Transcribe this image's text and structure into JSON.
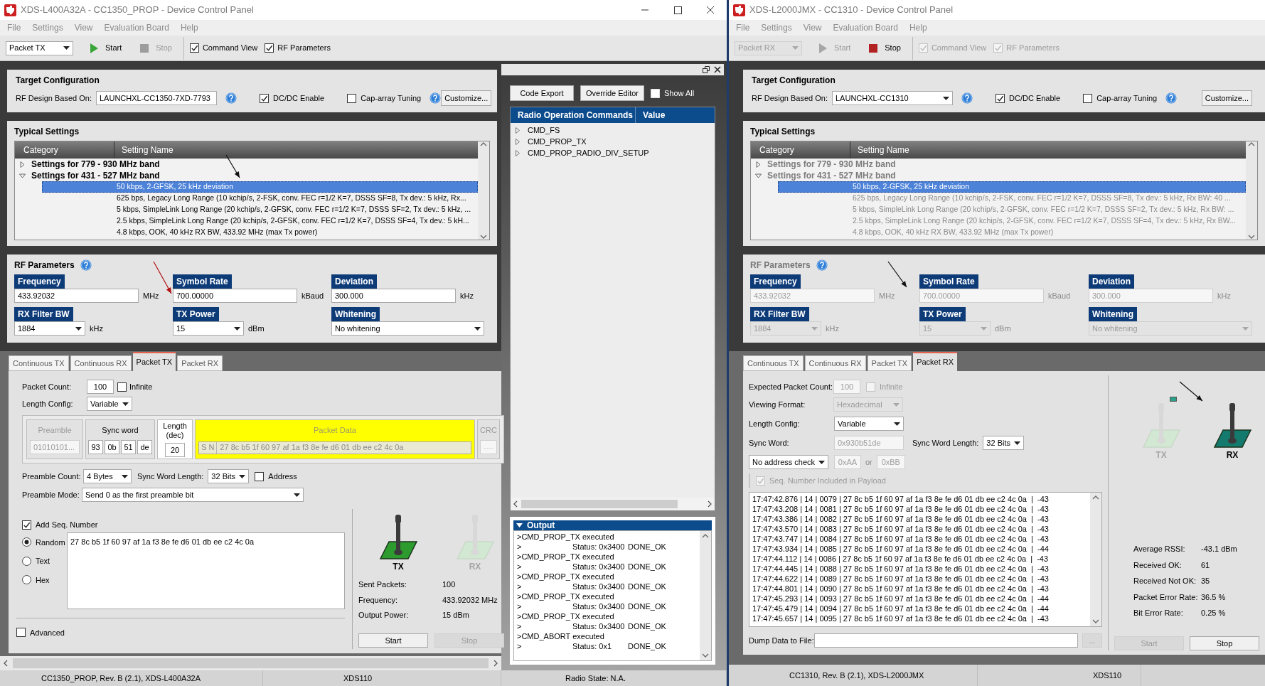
{
  "windows": [
    {
      "title": "XDS-L400A32A - CC1350_PROP - Device Control Panel",
      "window_controls": true,
      "menu": [
        "File",
        "Settings",
        "View",
        "Evaluation Board",
        "Help"
      ],
      "toolbar": {
        "mode": {
          "value": "Packet TX",
          "disabled": false
        },
        "start": {
          "label": "Start",
          "disabled": false
        },
        "stop": {
          "label": "Stop",
          "disabled": true
        },
        "toggles": [
          {
            "label": "Command View",
            "checked": true,
            "disabled": false
          },
          {
            "label": "RF Parameters",
            "checked": true,
            "disabled": false
          }
        ]
      },
      "target_configuration": {
        "title": "Target Configuration",
        "rf_design": {
          "label": "RF Design Based On:",
          "value": "LAUNCHXL-CC1350-7XD-7793"
        },
        "options": [
          {
            "label": "DC/DC Enable",
            "checked": true
          },
          {
            "label": "Cap-array Tuning",
            "checked": false
          }
        ],
        "customize": "Customize..."
      },
      "typical_settings": {
        "title": "Typical Settings",
        "disabled": false,
        "columns": [
          "Category",
          "Setting Name"
        ],
        "groups": [
          {
            "label": "Settings for 779 - 930 MHz band",
            "expanded": false
          },
          {
            "label": "Settings for 431 - 527 MHz band",
            "expanded": true,
            "children": [
              {
                "label": "50 kbps, 2-GFSK, 25 kHz deviation",
                "selected": true
              },
              {
                "label": "625 bps, Legacy Long Range (10 kchip/s, 2-FSK, conv. FEC r=1/2 K=7, DSSS SF=8, Tx dev.: 5 kHz, Rx...",
                "selected": false
              },
              {
                "label": "5 kbps, SimpleLink Long Range (20 kchip/s, 2-GFSK, conv. FEC r=1/2 K=7, DSSS SF=2, Tx dev.: 5 kHz, ...",
                "selected": false
              },
              {
                "label": "2.5 kbps, SimpleLink Long Range (20 kchip/s, 2-GFSK, conv. FEC r=1/2 K=7, DSSS SF=4, Tx dev.: 5 kH...",
                "selected": false
              },
              {
                "label": "4.8 kbps, OOK, 40 kHz RX BW, 433.92 MHz (max Tx power)",
                "selected": false
              }
            ]
          }
        ]
      },
      "rf_parameters": {
        "title": "RF Parameters",
        "disabled": false,
        "fields": [
          {
            "kind": "input",
            "label": "Frequency",
            "value": "433.92032",
            "unit": "MHz"
          },
          {
            "kind": "input",
            "label": "Symbol Rate",
            "value": "700.00000",
            "unit": "kBaud"
          },
          {
            "kind": "input",
            "label": "Deviation",
            "value": "300.000",
            "unit": "kHz"
          },
          {
            "kind": "select",
            "label": "RX Filter BW",
            "value": "1884",
            "unit": "kHz"
          },
          {
            "kind": "select",
            "label": "TX Power",
            "value": "15",
            "unit": "dBm"
          },
          {
            "kind": "select",
            "label": "Whitening",
            "value": "No whitening"
          }
        ]
      },
      "tabs": [
        {
          "label": "Continuous TX",
          "selected": false
        },
        {
          "label": "Continuous RX",
          "selected": false
        },
        {
          "label": "Packet TX",
          "selected": true
        },
        {
          "label": "Packet RX",
          "selected": false
        }
      ],
      "panel": {
        "kind": "packet_tx",
        "packet_count": {
          "label": "Packet Count:",
          "value": "100"
        },
        "infinite": {
          "label": "Infinite",
          "checked": false
        },
        "length_config": {
          "label": "Length Config:",
          "value": "Variable"
        },
        "structure": {
          "preamble": {
            "label": "Preamble",
            "value": "01010101...",
            "disabled": true
          },
          "sync_word": {
            "label": "Sync word",
            "bytes": [
              "93",
              "0b",
              "51",
              "de"
            ]
          },
          "length": {
            "label": "Length (dec)",
            "value": "20"
          },
          "packet_data": {
            "label": "Packet Data",
            "prefix": "S N",
            "value": "27 8c b5 1f 60 97 af 1a f3 8e fe d6 01 db ee c2 4c 0a"
          },
          "crc": {
            "label": "CRC",
            "value": "......",
            "disabled": true
          }
        },
        "preamble_count": {
          "label": "Preamble Count:",
          "value": "4 Bytes"
        },
        "sync_word_length": {
          "label": "Sync Word Length:",
          "value": "32 Bits"
        },
        "address": {
          "label": "Address",
          "checked": false
        },
        "preamble_mode": {
          "label": "Preamble Mode:",
          "value": "Send 0 as the first preamble bit"
        },
        "add_seq": {
          "label": "Add Seq. Number",
          "checked": true
        },
        "payload_modes": [
          {
            "label": "Random",
            "selected": true
          },
          {
            "label": "Text",
            "selected": false
          },
          {
            "label": "Hex",
            "selected": false
          }
        ],
        "payload": "27 8c b5 1f 60 97 af 1a f3 8e fe d6 01 db ee c2 4c 0a",
        "advanced": {
          "label": "Advanced",
          "checked": false
        },
        "indicators": [
          {
            "label": "TX",
            "active": true
          },
          {
            "label": "RX",
            "active": false
          }
        ],
        "stats": [
          {
            "label": "Sent Packets:",
            "value": "100"
          },
          {
            "label": "Frequency:",
            "value": "433.92032 MHz"
          },
          {
            "label": "Output Power:",
            "value": "15 dBm"
          }
        ],
        "buttons": [
          {
            "label": "Start",
            "disabled": false
          },
          {
            "label": "Stop",
            "disabled": true
          }
        ]
      },
      "command_view": {
        "buttons": [
          "Code Export",
          "Override Editor"
        ],
        "show_all": {
          "label": "Show All",
          "checked": false
        },
        "columns": [
          "Radio Operation Commands",
          "Value"
        ],
        "commands": [
          {
            "label": "CMD_FS",
            "expanded": false
          },
          {
            "label": "CMD_PROP_TX",
            "expanded": false
          },
          {
            "label": "CMD_PROP_RADIO_DIV_SETUP",
            "expanded": false
          }
        ],
        "output": {
          "title": "Output",
          "expanded": true,
          "lines": [
            {
              "kind": "message",
              "text": ">CMD_PROP_TX executed"
            },
            {
              "kind": "status",
              "prefix": ">",
              "code": "Status: 0x3400",
              "result": "DONE_OK"
            },
            {
              "kind": "message",
              "text": ">CMD_PROP_TX executed"
            },
            {
              "kind": "status",
              "prefix": ">",
              "code": "Status: 0x3400",
              "result": "DONE_OK"
            },
            {
              "kind": "message",
              "text": ">CMD_PROP_TX executed"
            },
            {
              "kind": "status",
              "prefix": ">",
              "code": "Status: 0x3400",
              "result": "DONE_OK"
            },
            {
              "kind": "message",
              "text": ">CMD_PROP_TX executed"
            },
            {
              "kind": "status",
              "prefix": ">",
              "code": "Status: 0x3400",
              "result": "DONE_OK"
            },
            {
              "kind": "message",
              "text": ">CMD_PROP_TX executed"
            },
            {
              "kind": "status",
              "prefix": ">",
              "code": "Status: 0x3400",
              "result": "DONE_OK"
            },
            {
              "kind": "message",
              "text": ">CMD_ABORT executed"
            },
            {
              "kind": "status",
              "prefix": ">",
              "code": "Status: 0x1",
              "result": "DONE_OK"
            }
          ]
        }
      },
      "status_bar": [
        "CC1350_PROP, Rev. B (2.1), XDS-L400A32A",
        "XDS110",
        "Radio State: N.A."
      ]
    },
    {
      "title": "XDS-L2000JMX - CC1310 - Device Control Panel",
      "window_controls": false,
      "menu": [
        "File",
        "Settings",
        "View",
        "Evaluation Board",
        "Help"
      ],
      "toolbar": {
        "mode": {
          "value": "Packet RX",
          "disabled": true
        },
        "start": {
          "label": "Start",
          "disabled": true
        },
        "stop": {
          "label": "Stop",
          "disabled": false
        },
        "toggles": [
          {
            "label": "Command View",
            "checked": true,
            "disabled": true
          },
          {
            "label": "RF Parameters",
            "checked": true,
            "disabled": true
          }
        ]
      },
      "target_configuration": {
        "title": "Target Configuration",
        "rf_design": {
          "label": "RF Design Based On:",
          "value": "LAUNCHXL-CC1310"
        },
        "options": [
          {
            "label": "DC/DC Enable",
            "checked": true
          },
          {
            "label": "Cap-array Tuning",
            "checked": false
          }
        ],
        "customize": "Customize..."
      },
      "typical_settings": {
        "title": "Typical Settings",
        "disabled": true,
        "columns": [
          "Category",
          "Setting Name"
        ],
        "groups": [
          {
            "label": "Settings for 779 - 930 MHz band",
            "expanded": false
          },
          {
            "label": "Settings for 431 - 527 MHz band",
            "expanded": true,
            "children": [
              {
                "label": "50 kbps, 2-GFSK, 25 kHz deviation",
                "selected": true
              },
              {
                "label": "625 bps, Legacy Long Range (10 kchip/s, 2-FSK, conv. FEC r=1/2 K=7, DSSS SF=8, Tx dev.: 5 kHz, Rx BW: 40 ...",
                "selected": false
              },
              {
                "label": "5 kbps, SimpleLink Long Range (20 kchip/s, 2-GFSK, conv. FEC r=1/2 K=7, DSSS SF=2, Tx dev.: 5 kHz, Rx BW: ...",
                "selected": false
              },
              {
                "label": "2.5 kbps, SimpleLink Long Range (20 kchip/s, 2-GFSK, conv. FEC r=1/2 K=7, DSSS SF=4, Tx dev.: 5 kHz, Rx BW...",
                "selected": false
              },
              {
                "label": "4.8 kbps, OOK, 40 kHz RX BW, 433.92 MHz (max Tx power)",
                "selected": false
              }
            ]
          }
        ]
      },
      "rf_parameters": {
        "title": "RF Parameters",
        "disabled": true,
        "fields": [
          {
            "kind": "input",
            "label": "Frequency",
            "value": "433.92032",
            "unit": "MHz"
          },
          {
            "kind": "input",
            "label": "Symbol Rate",
            "value": "700.00000",
            "unit": "kBaud"
          },
          {
            "kind": "input",
            "label": "Deviation",
            "value": "300.000",
            "unit": "kHz"
          },
          {
            "kind": "select",
            "label": "RX Filter BW",
            "value": "1884",
            "unit": "kHz"
          },
          {
            "kind": "select",
            "label": "TX Power",
            "value": "15",
            "unit": "dBm"
          },
          {
            "kind": "select",
            "label": "Whitening",
            "value": "No whitening"
          }
        ]
      },
      "tabs": [
        {
          "label": "Continuous TX",
          "selected": false
        },
        {
          "label": "Continuous RX",
          "selected": false
        },
        {
          "label": "Packet TX",
          "selected": false
        },
        {
          "label": "Packet RX",
          "selected": true
        }
      ],
      "panel": {
        "kind": "packet_rx",
        "expected_count": {
          "label": "Expected Packet Count:",
          "value": "100",
          "disabled": true
        },
        "infinite": {
          "label": "Infinite",
          "checked": false,
          "disabled": true
        },
        "viewing_format": {
          "label": "Viewing Format:",
          "value": "Hexadecimal",
          "disabled": true
        },
        "length_config": {
          "label": "Length Config:",
          "value": "Variable"
        },
        "sync_word": {
          "label": "Sync Word:",
          "value": "0x930b51de",
          "disabled": true
        },
        "sync_word_length": {
          "label": "Sync Word Length:",
          "value": "32 Bits"
        },
        "address_check": {
          "value": "No address check",
          "address_1": "0xAA",
          "separator": "or",
          "address_2": "0xBB",
          "disabled": true
        },
        "seq_included": {
          "label": "Seq. Number Included in Payload",
          "checked": true,
          "disabled": true
        },
        "log": [
          "17:47:42.876 | 14 | 0079 | 27 8c b5 1f 60 97 af 1a f3 8e fe d6 01 db ee c2 4c 0a  |  -43",
          "17:47:43.208 | 14 | 0081 | 27 8c b5 1f 60 97 af 1a f3 8e fe d6 01 db ee c2 4c 0a  |  -43",
          "17:47:43.386 | 14 | 0082 | 27 8c b5 1f 60 97 af 1a f3 8e fe d6 01 db ee c2 4c 0a  |  -43",
          "17:47:43.570 | 14 | 0083 | 27 8c b5 1f 60 97 af 1a f3 8e fe d6 01 db ee c2 4c 0a  |  -43",
          "17:47:43.747 | 14 | 0084 | 27 8c b5 1f 60 97 af 1a f3 8e fe d6 01 db ee c2 4c 0a  |  -43",
          "17:47:43.934 | 14 | 0085 | 27 8c b5 1f 60 97 af 1a f3 8e fe d6 01 db ee c2 4c 0a  |  -44",
          "17:47:44.112 | 14 | 0086 | 27 8c b5 1f 60 97 af 1a f3 8e fe d6 01 db ee c2 4c 0a  |  -43",
          "17:47:44.445 | 14 | 0088 | 27 8c b5 1f 60 97 af 1a f3 8e fe d6 01 db ee c2 4c 0a  |  -43",
          "17:47:44.622 | 14 | 0089 | 27 8c b5 1f 60 97 af 1a f3 8e fe d6 01 db ee c2 4c 0a  |  -43",
          "17:47:44.801 | 14 | 0090 | 27 8c b5 1f 60 97 af 1a f3 8e fe d6 01 db ee c2 4c 0a  |  -43",
          "17:47:45.293 | 14 | 0093 | 27 8c b5 1f 60 97 af 1a f3 8e fe d6 01 db ee c2 4c 0a  |  -44",
          "17:47:45.479 | 14 | 0094 | 27 8c b5 1f 60 97 af 1a f3 8e fe d6 01 db ee c2 4c 0a  |  -44",
          "17:47:45.657 | 14 | 0095 | 27 8c b5 1f 60 97 af 1a f3 8e fe d6 01 db ee c2 4c 0a  |  -43"
        ],
        "dump": {
          "label": "Dump Data to File:",
          "browse": "..."
        },
        "led_on": true,
        "indicators": [
          {
            "label": "TX",
            "active": false
          },
          {
            "label": "RX",
            "active": true
          }
        ],
        "stats": [
          {
            "label": "Average RSSI:",
            "value": "-43.1 dBm"
          },
          {
            "label": "Received OK:",
            "value": "61"
          },
          {
            "label": "Received Not OK:",
            "value": "35"
          },
          {
            "label": "Packet Error Rate:",
            "value": "36.5 %"
          },
          {
            "label": "Bit Error Rate:",
            "value": "0.25 %"
          }
        ],
        "buttons": [
          {
            "label": "Start",
            "disabled": true
          },
          {
            "label": "Stop",
            "disabled": false
          }
        ]
      },
      "status_bar": [
        "CC1310, Rev. B (2.1), XDS-L2000JMX",
        "XDS110"
      ]
    }
  ]
}
